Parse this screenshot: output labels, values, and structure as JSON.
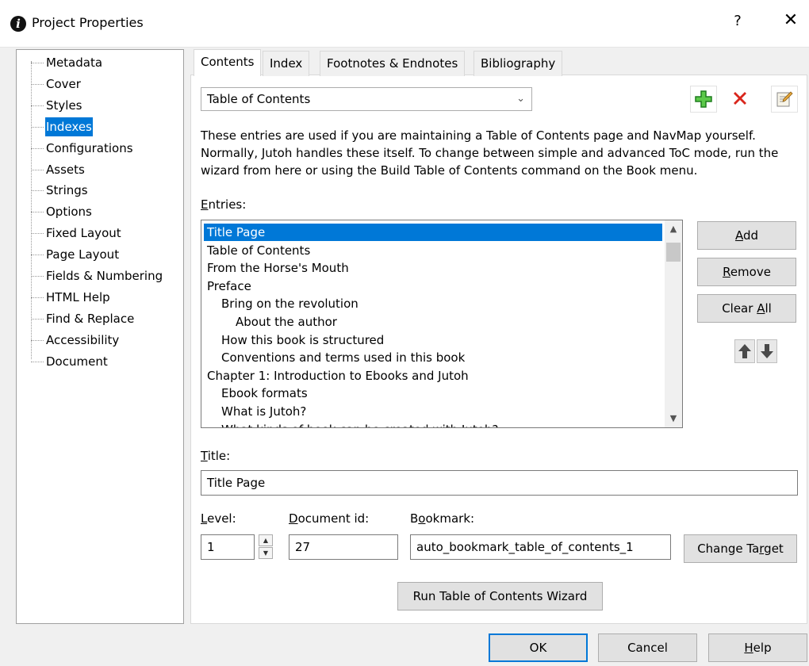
{
  "window": {
    "title": "Project Properties",
    "help": "?",
    "close": "✕"
  },
  "tree": {
    "items": [
      {
        "label": "Metadata"
      },
      {
        "label": "Cover"
      },
      {
        "label": "Styles"
      },
      {
        "label": "Indexes"
      },
      {
        "label": "Configurations"
      },
      {
        "label": "Assets"
      },
      {
        "label": "Strings"
      },
      {
        "label": "Options"
      },
      {
        "label": "Fixed Layout"
      },
      {
        "label": "Page Layout"
      },
      {
        "label": "Fields & Numbering"
      },
      {
        "label": "HTML Help"
      },
      {
        "label": "Find & Replace"
      },
      {
        "label": "Accessibility"
      },
      {
        "label": "Document"
      }
    ],
    "selected": "Indexes"
  },
  "tabs": [
    {
      "label": "Contents"
    },
    {
      "label": "Index"
    },
    {
      "label": "Footnotes & Endnotes"
    },
    {
      "label": "Bibliography"
    }
  ],
  "combo": {
    "value": "Table of Contents"
  },
  "toolbar": {
    "add_icon": "plus-icon",
    "delete_icon": "delete-x-icon",
    "edit_icon": "edit-icon"
  },
  "description": "These entries are used if you are maintaining a Table of Contents page and NavMap yourself. Normally, Jutoh handles these itself. To change between simple and advanced ToC mode, run the wizard from here or using the Build Table of Contents command on the Book menu.",
  "entries_label": {
    "pre": "",
    "u": "E",
    "post": "ntries:"
  },
  "entries": [
    {
      "text": "Title Page",
      "level": 1
    },
    {
      "text": "Table of Contents",
      "level": 1
    },
    {
      "text": "From the Horse's Mouth",
      "level": 1
    },
    {
      "text": "Preface",
      "level": 1
    },
    {
      "text": "Bring on the revolution",
      "level": 2
    },
    {
      "text": "About the author",
      "level": 3
    },
    {
      "text": "How this book is structured",
      "level": 2
    },
    {
      "text": "Conventions and terms used in this book",
      "level": 2
    },
    {
      "text": "Chapter 1: Introduction to Ebooks and Jutoh",
      "level": 1
    },
    {
      "text": "Ebook formats",
      "level": 2
    },
    {
      "text": "What is Jutoh?",
      "level": 2
    },
    {
      "text": "What kinds of book can be created with Jutoh?",
      "level": 2
    }
  ],
  "side_buttons": {
    "add": {
      "pre": "",
      "u": "A",
      "post": "dd"
    },
    "remove": {
      "pre": "",
      "u": "R",
      "post": "emove"
    },
    "clear": {
      "pre": "Clear ",
      "u": "A",
      "post": "ll"
    }
  },
  "title_label": {
    "pre": "",
    "u": "T",
    "post": "itle:"
  },
  "title_value": "Title Page",
  "level_label": {
    "pre": "",
    "u": "L",
    "post": "evel:"
  },
  "level_value": "1",
  "docid_label": {
    "pre": "",
    "u": "D",
    "post": "ocument id:"
  },
  "docid_value": "27",
  "bookmark_label": {
    "pre": "B",
    "u": "o",
    "post": "okmark:"
  },
  "bookmark_value": "auto_bookmark_table_of_contents_1",
  "change_target": {
    "pre": "Change Ta",
    "u": "r",
    "post": "get"
  },
  "wizard_button": "Run Table of Contents Wizard",
  "footer": {
    "ok": "OK",
    "cancel": "Cancel",
    "help": {
      "pre": "",
      "u": "H",
      "post": "elp"
    }
  }
}
